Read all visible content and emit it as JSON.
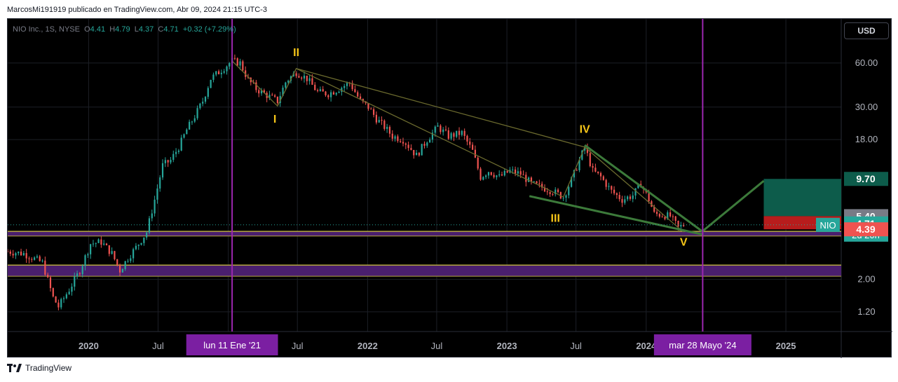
{
  "header": {
    "attribution": "MarcosMi191919 publicado en TradingView.com, Abr 09, 2024 21:15 UTC-3"
  },
  "legend": {
    "symbol": "NIO Inc., 1S, NYSE",
    "open_label": "O",
    "open": "4.41",
    "high_label": "H",
    "high": "4.79",
    "low_label": "L",
    "low": "4.37",
    "close_label": "C",
    "close": "4.71",
    "change": "+0.32 (+7.29%)"
  },
  "currency_button": "USD",
  "footer": {
    "brand": "TradingView"
  },
  "colors": {
    "up": "#26a69a",
    "down": "#ef5350",
    "wave_label": "#f5c518",
    "trendline": "#3c7a3a",
    "vertical_marker": "#9c27b0",
    "zone_fill": "#4a1f6e",
    "zone_edge": "#b5a642",
    "target_fill": "#0d5c4b",
    "stop_fill": "#b71c1c"
  },
  "chart_data": {
    "type": "candlestick",
    "symbol": "NIO",
    "y_scale": "log",
    "ylim": [
      0.88,
      120
    ],
    "y_ticks": [
      {
        "value": 60,
        "label": "60.00"
      },
      {
        "value": 30,
        "label": "30.00"
      },
      {
        "value": 18,
        "label": "18.00"
      },
      {
        "value": 9.7,
        "label": "9.70"
      },
      {
        "value": 5.4,
        "label": "5.40"
      },
      {
        "value": 2.0,
        "label": "2.00"
      },
      {
        "value": 1.2,
        "label": "1.20"
      }
    ],
    "x_ticks": [
      {
        "date": "2020-01-01",
        "label": "2020",
        "bold": true
      },
      {
        "date": "2020-07-01",
        "label": "Jul",
        "bold": false
      },
      {
        "date": "2021-01-01",
        "label": "2021",
        "bold": true
      },
      {
        "date": "2021-07-01",
        "label": "Jul",
        "bold": false
      },
      {
        "date": "2022-01-01",
        "label": "2022",
        "bold": true
      },
      {
        "date": "2022-07-01",
        "label": "Jul",
        "bold": false
      },
      {
        "date": "2023-01-01",
        "label": "2023",
        "bold": true
      },
      {
        "date": "2023-07-01",
        "label": "Jul",
        "bold": false
      },
      {
        "date": "2024-01-01",
        "label": "2024",
        "bold": true
      },
      {
        "date": "2025-01-01",
        "label": "2025",
        "bold": true
      }
    ],
    "xlim": [
      "2019-06-03",
      "2025-05-26"
    ],
    "price_path": [
      [
        "2019-06-03",
        3.1
      ],
      [
        "2019-07-15",
        3.0
      ],
      [
        "2019-09-02",
        2.6
      ],
      [
        "2019-09-30",
        1.5
      ],
      [
        "2019-10-14",
        1.3
      ],
      [
        "2019-11-11",
        1.7
      ],
      [
        "2019-12-09",
        2.3
      ],
      [
        "2020-01-06",
        3.5
      ],
      [
        "2020-02-03",
        3.6
      ],
      [
        "2020-03-02",
        3.0
      ],
      [
        "2020-03-23",
        2.3
      ],
      [
        "2020-04-13",
        2.8
      ],
      [
        "2020-05-04",
        3.3
      ],
      [
        "2020-06-01",
        4.2
      ],
      [
        "2020-06-22",
        7.0
      ],
      [
        "2020-07-13",
        12.0
      ],
      [
        "2020-08-03",
        13.0
      ],
      [
        "2020-08-24",
        16.0
      ],
      [
        "2020-09-14",
        21.0
      ],
      [
        "2020-10-05",
        26.0
      ],
      [
        "2020-10-26",
        33.0
      ],
      [
        "2020-11-16",
        47.0
      ],
      [
        "2020-12-07",
        52.0
      ],
      [
        "2021-01-04",
        60.0
      ],
      [
        "2021-01-11",
        62.0
      ],
      [
        "2021-02-01",
        60.0
      ],
      [
        "2021-02-22",
        46.0
      ],
      [
        "2021-03-15",
        40.0
      ],
      [
        "2021-04-05",
        37.0
      ],
      [
        "2021-05-10",
        33.0
      ],
      [
        "2021-06-01",
        45.0
      ],
      [
        "2021-06-28",
        52.0
      ],
      [
        "2021-07-26",
        47.0
      ],
      [
        "2021-08-23",
        38.0
      ],
      [
        "2021-09-20",
        37.0
      ],
      [
        "2021-10-18",
        40.0
      ],
      [
        "2021-11-15",
        44.0
      ],
      [
        "2021-12-13",
        33.0
      ],
      [
        "2022-01-03",
        30.0
      ],
      [
        "2022-01-24",
        25.0
      ],
      [
        "2022-02-14",
        22.0
      ],
      [
        "2022-03-07",
        19.0
      ],
      [
        "2022-04-04",
        18.0
      ],
      [
        "2022-05-09",
        14.0
      ],
      [
        "2022-06-06",
        18.0
      ],
      [
        "2022-07-04",
        22.0
      ],
      [
        "2022-08-01",
        19.0
      ],
      [
        "2022-09-05",
        20.0
      ],
      [
        "2022-10-03",
        15.0
      ],
      [
        "2022-10-24",
        10.0
      ],
      [
        "2022-11-14",
        11.0
      ],
      [
        "2022-12-12",
        10.0
      ],
      [
        "2023-01-09",
        11.0
      ],
      [
        "2023-02-06",
        10.5
      ],
      [
        "2023-03-06",
        9.0
      ],
      [
        "2023-04-03",
        8.5
      ],
      [
        "2023-05-01",
        8.0
      ],
      [
        "2023-05-29",
        7.3
      ],
      [
        "2023-06-19",
        9.5
      ],
      [
        "2023-07-10",
        13.0
      ],
      [
        "2023-07-24",
        16.0
      ],
      [
        "2023-08-14",
        11.0
      ],
      [
        "2023-09-04",
        10.0
      ],
      [
        "2023-10-02",
        8.0
      ],
      [
        "2023-10-30",
        7.0
      ],
      [
        "2023-11-27",
        7.5
      ],
      [
        "2023-12-18",
        9.0
      ],
      [
        "2024-01-08",
        7.0
      ],
      [
        "2024-01-22",
        5.6
      ],
      [
        "2024-02-12",
        5.5
      ],
      [
        "2024-03-04",
        5.4
      ],
      [
        "2024-03-25",
        4.5
      ],
      [
        "2024-04-08",
        4.71
      ]
    ],
    "wave_labels": [
      {
        "text": "I",
        "date": "2021-05-03",
        "price": 23.5
      },
      {
        "text": "II",
        "date": "2021-06-28",
        "price": 67
      },
      {
        "text": "III",
        "date": "2023-05-08",
        "price": 4.95
      },
      {
        "text": "IV",
        "date": "2023-07-24",
        "price": 20.0
      },
      {
        "text": "V",
        "date": "2024-04-08",
        "price": 3.4
      }
    ],
    "wave_lines": [
      [
        [
          "2021-01-11",
          62
        ],
        [
          "2021-05-10",
          30.5
        ],
        [
          "2021-06-28",
          55
        ],
        [
          "2023-05-29",
          7.3
        ],
        [
          "2023-07-24",
          16.0
        ],
        [
          "2024-04-08",
          4.2
        ]
      ],
      [
        [
          "2021-06-28",
          55
        ],
        [
          "2023-07-24",
          16.0
        ]
      ]
    ],
    "wedge_lines": [
      [
        [
          "2023-03-01",
          7.4
        ],
        [
          "2024-05-27",
          4.05
        ]
      ],
      [
        [
          "2023-07-24",
          16.5
        ],
        [
          "2024-05-27",
          4.25
        ]
      ]
    ],
    "projection": [
      [
        "2024-05-27",
        4.25
      ],
      [
        "2024-11-04",
        9.4
      ]
    ],
    "zones": [
      {
        "from": 3.95,
        "to": 4.25
      },
      {
        "from": 2.1,
        "to": 2.5
      }
    ],
    "position": {
      "from_date": "2024-11-04",
      "to_date": "2025-05-26",
      "entry": 5.4,
      "target": 9.7,
      "stop": 4.39
    },
    "price_marks": [
      {
        "value": 9.7,
        "label": "9.70",
        "color": "#0d5c4b"
      },
      {
        "value": 5.4,
        "label": "5.40",
        "color": "#787b86"
      },
      {
        "value": 4.71,
        "label": "4.71",
        "sublabel": "2d 20h",
        "color": "#26a69a",
        "tag": "NIO"
      },
      {
        "value": 4.39,
        "label": "4.39",
        "color": "#ef5350"
      }
    ],
    "vertical_markers": [
      {
        "date": "2021-01-11",
        "label": "lun 11 Ene '21"
      },
      {
        "date": "2024-05-28",
        "label": "mar 28 Mayo '24"
      }
    ]
  }
}
